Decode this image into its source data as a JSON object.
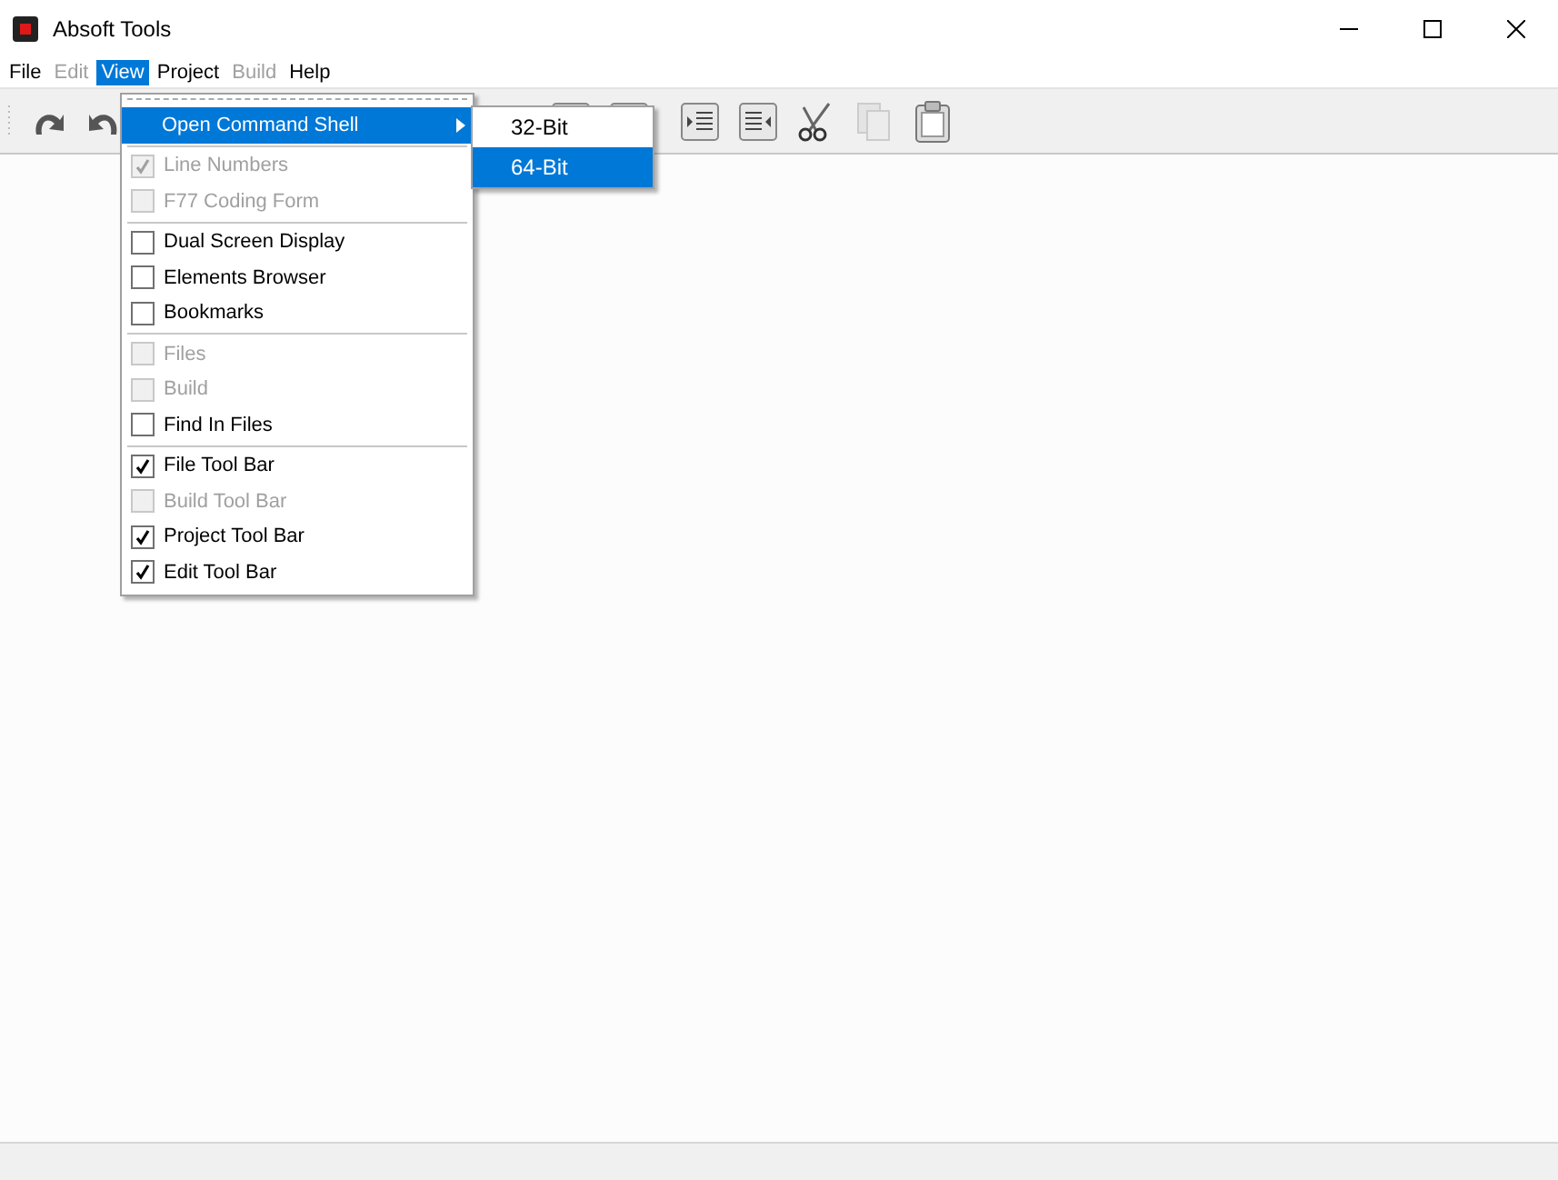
{
  "window": {
    "title": "Absoft Tools"
  },
  "menubar": [
    {
      "label": "File",
      "disabled": false,
      "selected": false
    },
    {
      "label": "Edit",
      "disabled": true,
      "selected": false
    },
    {
      "label": "View",
      "disabled": false,
      "selected": true
    },
    {
      "label": "Project",
      "disabled": false,
      "selected": false
    },
    {
      "label": "Build",
      "disabled": true,
      "selected": false
    },
    {
      "label": "Help",
      "disabled": false,
      "selected": false
    }
  ],
  "view_menu": [
    {
      "kind": "submenu",
      "label": "Open Command Shell",
      "selected": true
    },
    {
      "kind": "separator"
    },
    {
      "kind": "check",
      "label": "Line Numbers",
      "checked": true,
      "disabled": true
    },
    {
      "kind": "check",
      "label": "F77 Coding Form",
      "checked": false,
      "disabled": true
    },
    {
      "kind": "separator"
    },
    {
      "kind": "check",
      "label": "Dual Screen Display",
      "checked": false,
      "disabled": false
    },
    {
      "kind": "check",
      "label": "Elements Browser",
      "checked": false,
      "disabled": false
    },
    {
      "kind": "check",
      "label": "Bookmarks",
      "checked": false,
      "disabled": false
    },
    {
      "kind": "separator"
    },
    {
      "kind": "check",
      "label": "Files",
      "checked": false,
      "disabled": true
    },
    {
      "kind": "check",
      "label": "Build",
      "checked": false,
      "disabled": true
    },
    {
      "kind": "check",
      "label": "Find In Files",
      "checked": false,
      "disabled": false
    },
    {
      "kind": "separator"
    },
    {
      "kind": "check",
      "label": "File Tool Bar",
      "checked": true,
      "disabled": false
    },
    {
      "kind": "check",
      "label": "Build Tool Bar",
      "checked": false,
      "disabled": true
    },
    {
      "kind": "check",
      "label": "Project Tool Bar",
      "checked": true,
      "disabled": false
    },
    {
      "kind": "check",
      "label": "Edit Tool Bar",
      "checked": true,
      "disabled": false
    }
  ],
  "submenu": [
    {
      "label": "32-Bit",
      "selected": false
    },
    {
      "label": "64-Bit",
      "selected": true
    }
  ]
}
